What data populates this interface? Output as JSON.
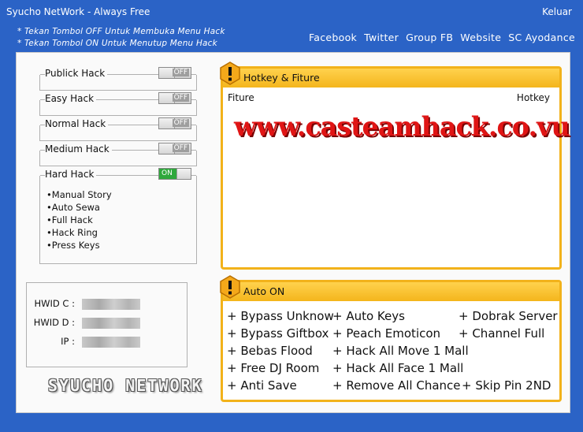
{
  "window": {
    "title": "Syucho NetWork - Always Free",
    "close_label": "Keluar"
  },
  "notes": [
    "* Tekan Tombol OFF Untuk Membuka Menu Hack",
    "* Tekan Tombol ON Untuk Menutup Menu Hack"
  ],
  "links": [
    "Facebook",
    "Twitter",
    "Group FB",
    "Website",
    "SC Ayodance"
  ],
  "hacks": [
    {
      "label": "Publick Hack",
      "state": "OFF"
    },
    {
      "label": "Easy Hack",
      "state": "OFF"
    },
    {
      "label": "Normal Hack",
      "state": "OFF"
    },
    {
      "label": "Medium Hack",
      "state": "OFF"
    }
  ],
  "hard_hack": {
    "label": "Hard Hack",
    "state": "ON",
    "items": [
      "Manual Story",
      "Auto Sewa",
      "Full Hack",
      "Hack Ring",
      "Press Keys"
    ]
  },
  "hwid": [
    {
      "label": "HWID C :"
    },
    {
      "label": "HWID D :"
    },
    {
      "label": "IP :"
    }
  ],
  "logo_text": "SYUCHO NETWORK",
  "hotkey_box": {
    "title": "Hotkey & Fiture",
    "col_fiture": "Fiture",
    "col_hotkey": "Hotkey",
    "watermark": "www.casteamhack.co.vu"
  },
  "auto_on": {
    "title": "Auto ON",
    "items": [
      "+ Bypass Unknow",
      "+ Auto Keys",
      "+ Dobrak Server",
      "+ Bypass Giftbox",
      "+ Peach Emoticon",
      "+ Channel Full",
      "+ Bebas Flood",
      "+ Hack All Move 1 Mall",
      "+ Free DJ Room",
      "+ Hack All Face 1 Mall",
      "+ Anti Save",
      "+ Remove All Chance",
      "+ Skip Pin 2ND"
    ]
  },
  "colors": {
    "window_blue": "#2b63c6",
    "box_border": "#f2b21a",
    "on_green": "#2fa83c",
    "watermark_red": "#e01515"
  }
}
